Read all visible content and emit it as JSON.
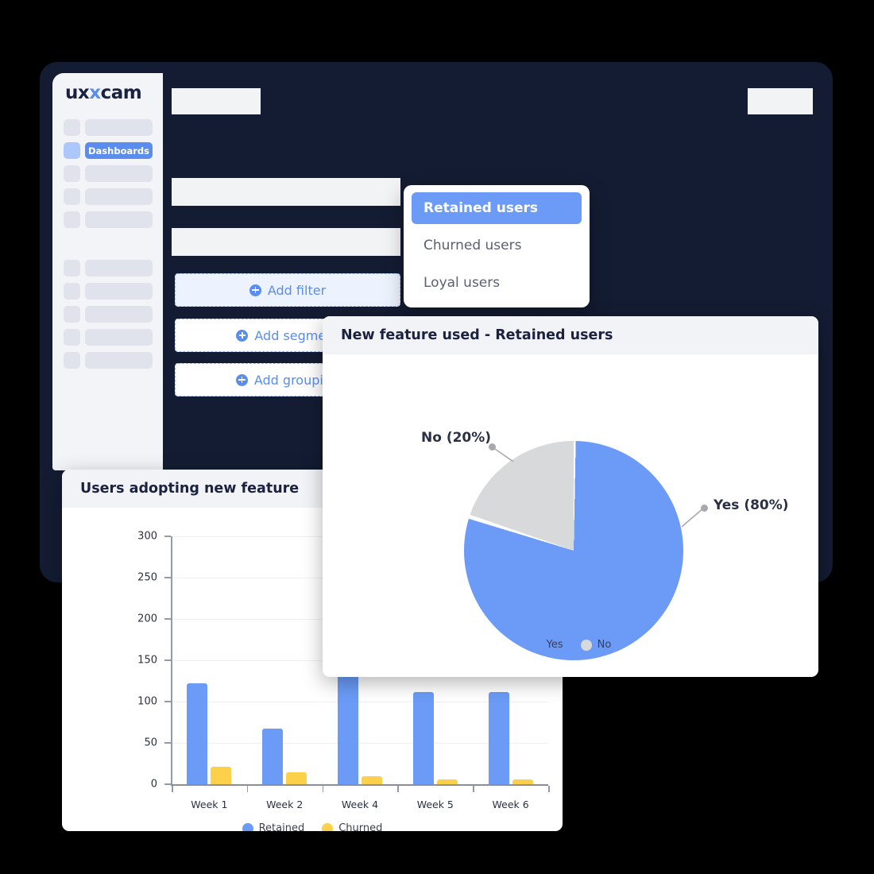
{
  "brand": {
    "logo_text_left": "ux",
    "logo_text_x": "x",
    "logo_text_right": "cam",
    "accent_blue": "#5B8DEF",
    "pie_blue": "#6B9BF7",
    "pie_gray": "#D8D9DB",
    "bar_blue": "#6B9BF7",
    "bar_yellow": "#FCD04B",
    "window_dark": "#141C33"
  },
  "sidebar": {
    "items": [
      {
        "label": "",
        "active": false
      },
      {
        "label": "Dashboards",
        "active": true
      },
      {
        "label": "",
        "active": false
      },
      {
        "label": "",
        "active": false
      },
      {
        "label": "",
        "active": false
      }
    ],
    "items_secondary": [
      {
        "label": "",
        "active": false
      },
      {
        "label": "",
        "active": false
      },
      {
        "label": "",
        "active": false
      },
      {
        "label": "",
        "active": false
      },
      {
        "label": "",
        "active": false
      }
    ]
  },
  "builder": {
    "add_filter": "Add filter",
    "add_segment": "Add segment",
    "add_grouping": "Add grouping"
  },
  "dropdown": {
    "options": [
      {
        "label": "Retained users",
        "selected": true
      },
      {
        "label": "Churned users",
        "selected": false
      },
      {
        "label": "Loyal users",
        "selected": false
      }
    ]
  },
  "pie_card": {
    "title": "New feature used - Retained users",
    "label_no": "No (20%)",
    "label_yes": "Yes (80%)"
  },
  "bar_card": {
    "title": "Users adopting new feature"
  },
  "chart_data": [
    {
      "type": "bar",
      "title": "Users adopting new feature",
      "categories": [
        "Week 1",
        "Week 2",
        "Week 4",
        "Week 5",
        "Week 6"
      ],
      "series": [
        {
          "name": "Retained",
          "color": "#6B9BF7",
          "values": [
            122,
            67,
            183,
            112,
            112
          ]
        },
        {
          "name": "Churned",
          "color": "#FCD04B",
          "values": [
            21,
            14,
            10,
            6,
            6
          ]
        }
      ],
      "xlabel": "",
      "ylabel": "",
      "ylim": [
        0,
        300
      ],
      "yticks": [
        0,
        50,
        100,
        150,
        200,
        250,
        300
      ],
      "grid": true,
      "legend_position": "bottom"
    },
    {
      "type": "pie",
      "title": "New feature used - Retained users",
      "labels": [
        "Yes",
        "No"
      ],
      "values": [
        80,
        20
      ],
      "value_labels": [
        "Yes (80%)",
        "No (20%)"
      ],
      "colors": [
        "#6B9BF7",
        "#D8D9DB"
      ],
      "legend_position": "bottom",
      "legend": [
        "Yes",
        "No"
      ]
    }
  ]
}
